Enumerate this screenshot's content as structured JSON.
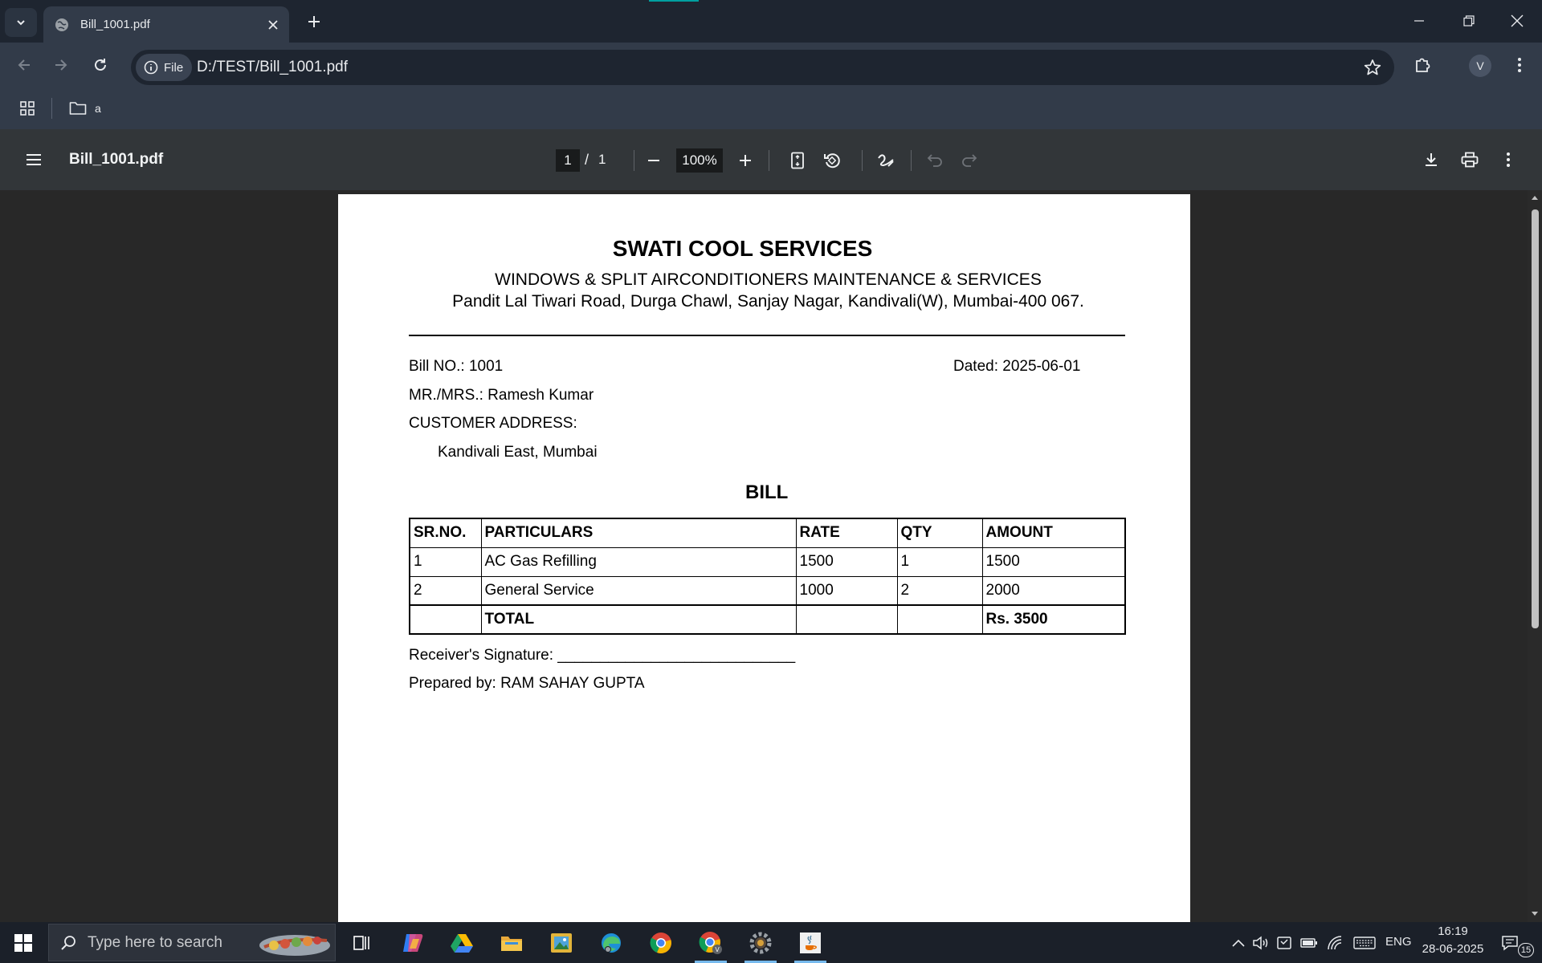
{
  "browser": {
    "tab_title": "Bill_1001.pdf",
    "site_chip_label": "File",
    "url": "D:/TEST/Bill_1001.pdf",
    "profile_initial": "V",
    "bookmark_folder": "a"
  },
  "pdf_viewer": {
    "title": "Bill_1001.pdf",
    "current_page": "1",
    "page_separator": "/",
    "total_pages": "1",
    "zoom": "100%"
  },
  "document": {
    "company_name": "SWATI COOL SERVICES",
    "subheading": "WINDOWS & SPLIT AIRCONDITIONERS MAINTENANCE & SERVICES",
    "address": "Pandit Lal Tiwari Road, Durga Chawl, Sanjay Nagar, Kandivali(W), Mumbai-400 067.",
    "bill_no": "Bill NO.: 1001",
    "dated": "Dated: 2025-06-01",
    "customer": "MR./MRS.: Ramesh Kumar",
    "customer_address_label": "CUSTOMER ADDRESS:",
    "customer_address": "Kandivali East, Mumbai",
    "bill_heading": "BILL",
    "table": {
      "headers": [
        "SR.NO.",
        "PARTICULARS",
        "RATE",
        "QTY",
        "AMOUNT"
      ],
      "rows": [
        [
          "1",
          "AC Gas Refilling",
          "1500",
          "1",
          "1500"
        ],
        [
          "2",
          "General Service",
          "1000",
          "2",
          "2000"
        ]
      ],
      "total_label": "TOTAL",
      "total_amount": "Rs. 3500"
    },
    "signature_label": "Receiver's Signature: ____________________________",
    "prepared_by": "Prepared by: RAM SAHAY GUPTA"
  },
  "taskbar": {
    "search_placeholder": "Type here to search",
    "language": "ENG",
    "time": "16:19",
    "date": "28-06-2025",
    "notification_count": "15"
  }
}
